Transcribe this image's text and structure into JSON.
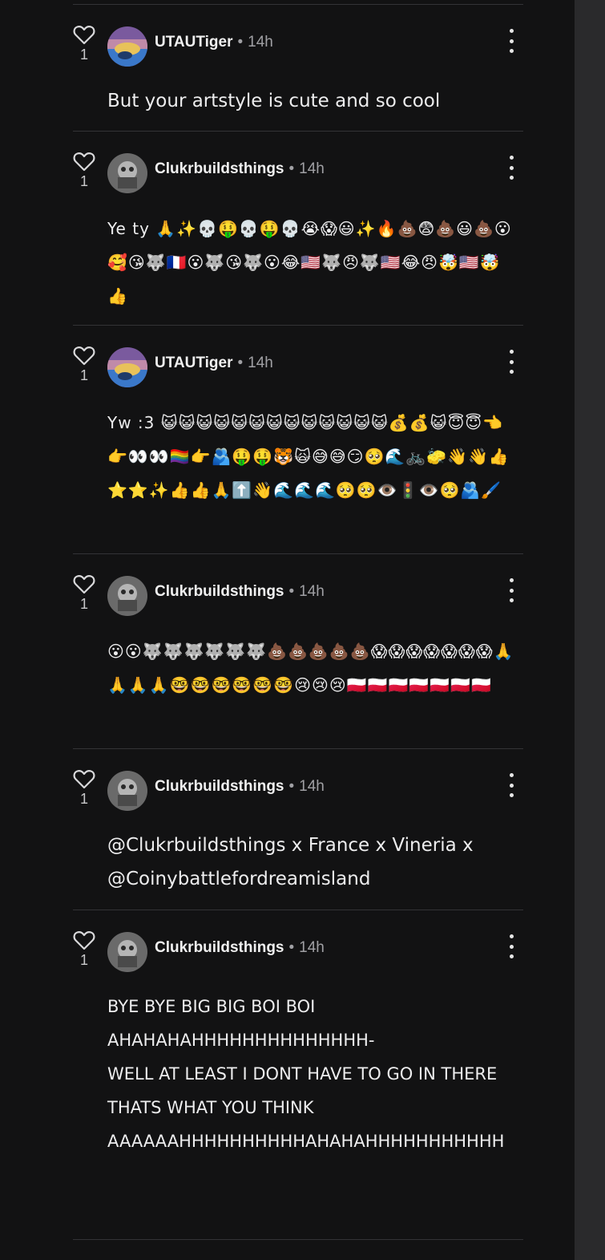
{
  "comments": [
    {
      "user": "UTAUTiger",
      "time": "14h",
      "likes": "1",
      "text": "But your artstyle is cute and so cool"
    },
    {
      "user": "Clukrbuildsthings",
      "time": "14h",
      "likes": "1",
      "text": "Ye ty 🙏✨💀🤑💀🤑💀😭😱😃✨🔥💩😨💩😃💩😮🥰😘🐺🇫🇷😮🐺😘🐺😮😂🇺🇸🐺😠🐺🇺🇸😂😠🤯🇺🇸🤯👍"
    },
    {
      "user": "UTAUTiger",
      "time": "14h",
      "likes": "1",
      "text": "Yw :3 😺😺😺😺😺😺😺😺😺😺😺😺😺💰💰😺😇😇👈👉👀👀🏳️‍🌈👉🫂🤑🤑🐯🙀😅😅😏🥺🌊🚲🧽👋👋👍⭐⭐✨👍👍🙏⬆️👋🌊🌊🌊🥺🥺👁️🚦👁️🥺🫂🖌️"
    },
    {
      "user": "Clukrbuildsthings",
      "time": "14h",
      "likes": "1",
      "text": "😮😮🐺🐺🐺🐺🐺🐺💩💩💩💩💩😱😱😱😱😱😱😱🙏🙏🙏🙏🤓🤓🤓🤓🤓🤓😢😢😢🇵🇱🇵🇱🇵🇱🇵🇱🇵🇱🇵🇱🇵🇱"
    },
    {
      "user": "Clukrbuildsthings",
      "time": "14h",
      "likes": "1",
      "text": "@Clukrbuildsthings x France x Vineria x @Coinybattlefordreamisland"
    },
    {
      "user": "Clukrbuildsthings",
      "time": "14h",
      "likes": "1",
      "text": "BYE BYE BIG BIG BOI BOI\nAHAHAHAHHHHHHHHHHHHHH-\nWELL AT LEAST I DONT HAVE TO GO IN THERE\nTHATS WHAT YOU THINK\nAAAAAAHHHHHHHHHHAHAHAHHHHHHHHHHH"
    }
  ],
  "colors": {
    "background": "#121213",
    "separator": "#333336",
    "username": "#f0f0f0",
    "meta": "#a0a0a4",
    "scrollbar": "#2a2a2c"
  }
}
